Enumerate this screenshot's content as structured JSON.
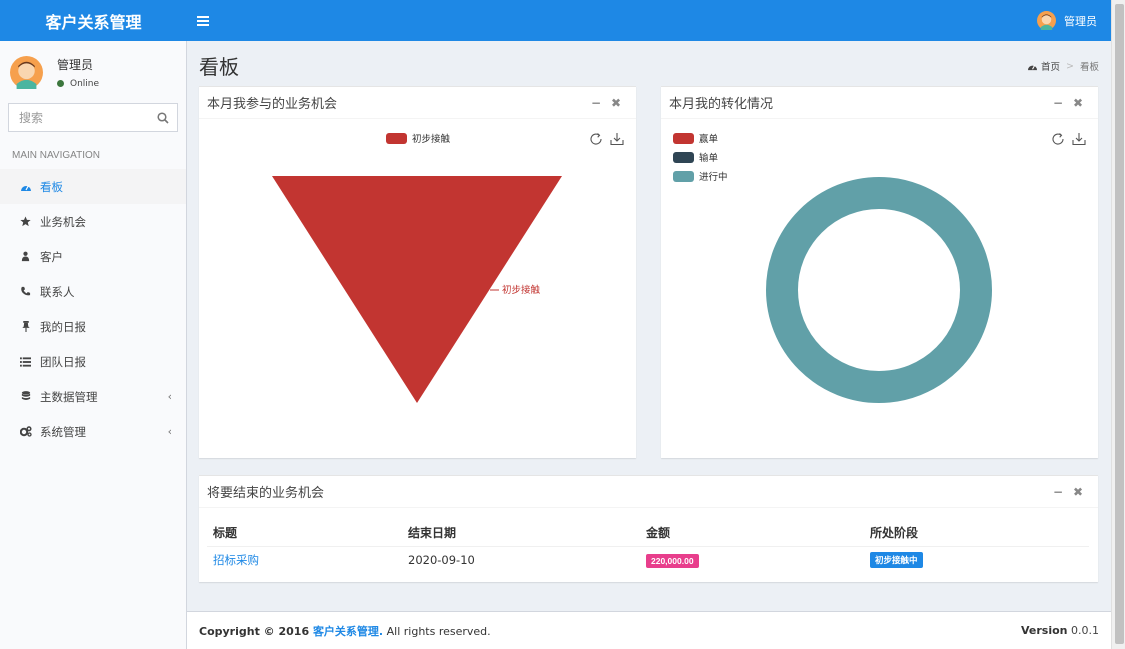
{
  "app": {
    "title": "客户关系管理",
    "menu_toggle": "≡"
  },
  "user": {
    "name": "管理员",
    "status": "Online"
  },
  "search": {
    "placeholder": "搜索"
  },
  "nav": {
    "header": "MAIN NAVIGATION",
    "items": [
      {
        "label": "看板",
        "icon": "dashboard-icon"
      },
      {
        "label": "业务机会",
        "icon": "star-icon"
      },
      {
        "label": "客户",
        "icon": "sitemap-icon"
      },
      {
        "label": "联系人",
        "icon": "phone-icon"
      },
      {
        "label": "我的日报",
        "icon": "pin-icon"
      },
      {
        "label": "团队日报",
        "icon": "list-icon"
      },
      {
        "label": "主数据管理",
        "icon": "database-icon"
      },
      {
        "label": "系统管理",
        "icon": "gears-icon"
      }
    ]
  },
  "page": {
    "title": "看板"
  },
  "breadcrumb": {
    "home": "首页",
    "current": "看板"
  },
  "colors": {
    "brand": "#1e88e5",
    "red": "#c23531",
    "dark": "#2f4554",
    "teal": "#61a0a8",
    "pink": "#e83e8c"
  },
  "box1": {
    "title": "本月我参与的业务机会",
    "legend": [
      "初步接触"
    ],
    "label": "初步接触"
  },
  "box2": {
    "title": "本月我的转化情况",
    "legend": [
      "赢单",
      "输单",
      "进行中"
    ]
  },
  "box3": {
    "title": "将要结束的业务机会",
    "columns": [
      "标题",
      "结束日期",
      "金额",
      "所处阶段"
    ],
    "rows": [
      {
        "title": "招标采购",
        "end_date": "2020-09-10",
        "amount": "220,000.00",
        "stage": "初步接触中"
      }
    ]
  },
  "chart_data": [
    {
      "type": "funnel",
      "legend": [
        "初步接触"
      ],
      "categories": [
        "初步接触"
      ],
      "values": [
        1
      ]
    },
    {
      "type": "pie",
      "legend": [
        "赢单",
        "输单",
        "进行中"
      ],
      "categories": [
        "赢单",
        "输单",
        "进行中"
      ],
      "values": [
        0,
        0,
        1
      ]
    }
  ],
  "footer": {
    "copy_prefix": "Copyright © 2016 ",
    "copy_link": "客户关系管理.",
    "copy_suffix": " All rights reserved.",
    "version_label": "Version",
    "version": "0.0.1"
  }
}
